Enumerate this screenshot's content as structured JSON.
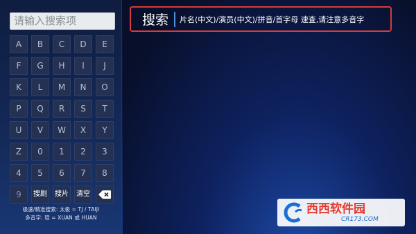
{
  "search": {
    "placeholder": "请输入搜索项"
  },
  "keyboard": {
    "keys": [
      "A",
      "B",
      "C",
      "D",
      "E",
      "F",
      "G",
      "H",
      "I",
      "J",
      "K",
      "L",
      "M",
      "N",
      "O",
      "P",
      "Q",
      "R",
      "S",
      "T",
      "U",
      "V",
      "W",
      "X",
      "Y",
      "Z",
      "0",
      "1",
      "2",
      "3",
      "4",
      "5",
      "6",
      "7",
      "8",
      "9",
      "搜剧",
      "搜片",
      "清空"
    ],
    "backspace_icon": "backspace-icon"
  },
  "hints": {
    "line1": "极速/精准搜索: 太极 = TJ / TAIJI",
    "line2": "多音字: 瑄 = XUAN 或 HUAN"
  },
  "header": {
    "title": "搜索",
    "description": "片名(中文)/演员(中文)/拼音/首字母 速查,请注意多音字"
  },
  "watermark": {
    "brand": "西西软件园",
    "url": "CR173.COM"
  },
  "colors": {
    "highlight_border": "#d63c3a",
    "divider": "#4a8fe0",
    "key_bg": "#243152"
  }
}
